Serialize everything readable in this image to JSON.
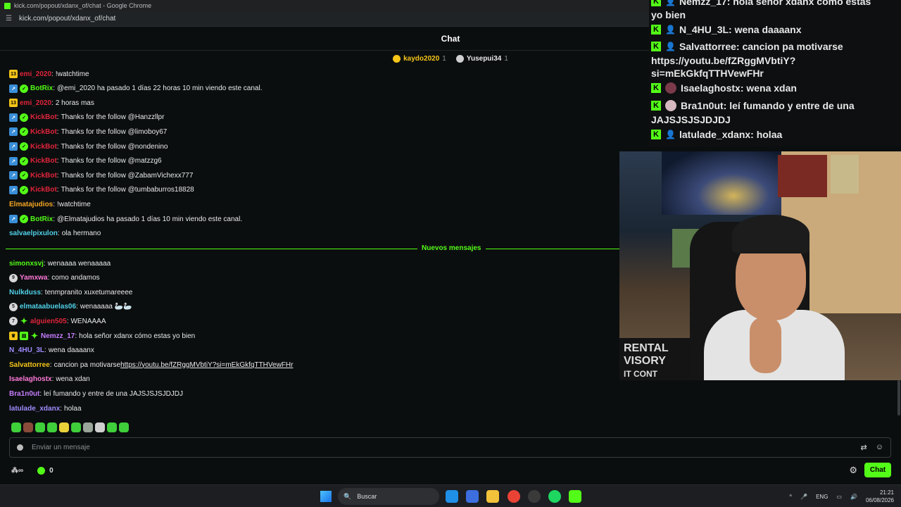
{
  "browser": {
    "window_title": "kick.com/popout/xdanx_of/chat - Google Chrome",
    "url": "kick.com/popout/xdanx_of/chat"
  },
  "header": {
    "title": "Chat"
  },
  "pinned_gifters": [
    {
      "name": "kaydo2020",
      "count": "1",
      "color": "#f5c518"
    },
    {
      "name": "Yusepui34",
      "count": "1",
      "color": "#cfcfcf"
    }
  ],
  "messages": [
    {
      "badges": [
        "sub-13"
      ],
      "user": "emi_2020",
      "color": "#e0243a",
      "text": "!watchtime"
    },
    {
      "badges": [
        "bot",
        "verified"
      ],
      "user": "BotRix",
      "color": "#53fc18",
      "text": "@emi_2020 ha pasado 1 días 22 horas 10 min viendo este canal."
    },
    {
      "badges": [
        "sub-13"
      ],
      "user": "emi_2020",
      "color": "#e0243a",
      "text": "2 horas mas"
    },
    {
      "badges": [
        "bot",
        "verified"
      ],
      "user": "KickBot",
      "color": "#e0243a",
      "text": "Thanks for the follow @Hanzzllpr"
    },
    {
      "badges": [
        "bot",
        "verified"
      ],
      "user": "KickBot",
      "color": "#e0243a",
      "text": "Thanks for the follow @limoboy67"
    },
    {
      "badges": [
        "bot",
        "verified"
      ],
      "user": "KickBot",
      "color": "#e0243a",
      "text": "Thanks for the follow @nondenino"
    },
    {
      "badges": [
        "bot",
        "verified"
      ],
      "user": "KickBot",
      "color": "#e0243a",
      "text": "Thanks for the follow @matzzg6"
    },
    {
      "badges": [
        "bot",
        "verified"
      ],
      "user": "KickBot",
      "color": "#e0243a",
      "text": "Thanks for the follow @ZabamVichexx777"
    },
    {
      "badges": [
        "bot",
        "verified"
      ],
      "user": "KickBot",
      "color": "#e0243a",
      "text": "Thanks for the follow @tumbaburros18828"
    },
    {
      "badges": [],
      "user": "Elmatajudios",
      "color": "#f5a623",
      "text": "!watchtime"
    },
    {
      "badges": [
        "bot",
        "verified"
      ],
      "user": "BotRix",
      "color": "#53fc18",
      "text": "@Elmatajudios ha pasado 1 días 10 min viendo este canal."
    },
    {
      "badges": [],
      "user": "salvaelpixulon",
      "color": "#4fd1e8",
      "text": "ola hermano"
    }
  ],
  "new_messages_label": "Nuevos mensajes",
  "new_messages": [
    {
      "badges": [],
      "user": "simonxsvj",
      "color": "#53fc18",
      "text": "wenaaaa wenaaaaa"
    },
    {
      "badges": [
        "gray-9"
      ],
      "user": "Yamxwa",
      "color": "#ff7ad9",
      "text": "como andamos"
    },
    {
      "badges": [],
      "user": "Nulkduss",
      "color": "#4fd1e8",
      "text": "tenmpranito xuxetumareeee"
    },
    {
      "badges": [
        "gray-5"
      ],
      "user": "elmataabuelas06",
      "color": "#4fd1e8",
      "text": "wenaaaaa 🦢🦢"
    },
    {
      "badges": [
        "gray-7",
        "green-star"
      ],
      "user": "alguien505",
      "color": "#e0243a",
      "text": "WENAAAA"
    },
    {
      "badges": [
        "crown",
        "gift",
        "green-star"
      ],
      "user": "Nemzz_17",
      "color": "#c77dff",
      "text": "hola señor xdanx cómo estas yo bien"
    },
    {
      "badges": [],
      "user": "N_4HU_3L",
      "color": "#9f8cff",
      "text": "wena daaaanx"
    },
    {
      "badges": [],
      "user": "Salvattorree",
      "color": "#f5c518",
      "text": "cancion pa motivarse ",
      "link": "https://youtu.be/fZRggMVbtiY?si=mEkGkfqTTHVewFHr"
    },
    {
      "badges": [],
      "user": "Isaelaghostx",
      "color": "#ff7ad9",
      "text": "wena xdan"
    },
    {
      "badges": [],
      "user": "Bra1n0ut",
      "color": "#c77dff",
      "text": "leí fumando y entre de una JAJSJSJSJDJDJ"
    },
    {
      "badges": [],
      "user": "latulade_xdanx",
      "color": "#9f8cff",
      "text": "holaa"
    }
  ],
  "input": {
    "placeholder": "Enviar un mensaje"
  },
  "footer": {
    "points": "0",
    "chat_button": "Chat"
  },
  "overlay_chat": {
    "first_line_partial": "Nemzz_17: hola señor xdanx cómo estas",
    "first_line_cont": "yo bien",
    "lines": [
      {
        "icon": "user",
        "text": "N_4HU_3L: wena daaaanx"
      },
      {
        "icon": "user",
        "text": "Salvattorree: cancion pa motivarse"
      },
      {
        "icon": "none",
        "text": "https://youtu.be/fZRggMVbtiY?"
      },
      {
        "icon": "none",
        "text": "si=mEkGkfqTTHVewFHr"
      },
      {
        "icon": "avatar",
        "text": "Isaelaghostx: wena xdan"
      },
      {
        "icon": "avatar",
        "text": "Bra1n0ut: leí fumando y entre de una"
      },
      {
        "icon": "none",
        "text": "JAJSJSJSJDJDJ"
      },
      {
        "icon": "user",
        "text": "latulade_xdanx: holaa"
      }
    ]
  },
  "webcam": {
    "sign_text_1": "RENTAL",
    "sign_text_2": "VISORY",
    "sign_text_3": "IT CONT"
  },
  "taskbar": {
    "search_placeholder": "Buscar",
    "language": "ENG",
    "time": "21:21",
    "date": "06/08/2026"
  },
  "colors": {
    "kick_green": "#53fc18",
    "background": "#0b0e0f"
  }
}
